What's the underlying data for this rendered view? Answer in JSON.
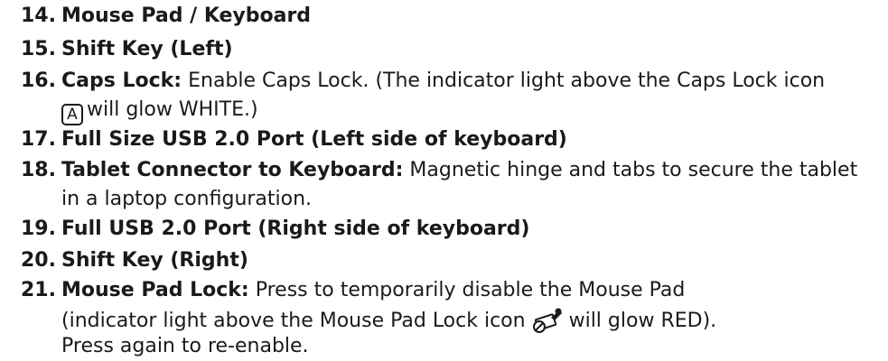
{
  "items": [
    {
      "number": "14.",
      "title": "Mouse Pad / Keyboard"
    },
    {
      "number": "15.",
      "title": "Shift Key (Left)"
    },
    {
      "number": "16.",
      "title": "Caps Lock:",
      "text": "Enable Caps Lock. (The indicator light above the Caps Lock icon",
      "cont_icon": "caps-lock-icon",
      "cont_icon_glyph": "A",
      "cont_text": "will glow WHITE.)"
    },
    {
      "number": "17.",
      "title": "Full Size USB 2.0 Port (Left side of keyboard)"
    },
    {
      "number": "18.",
      "title": "Tablet Connector to Keyboard:",
      "text": "Magnetic hinge and tabs to secure the tablet",
      "cont_text": "in a laptop configuration."
    },
    {
      "number": "19.",
      "title": "Full USB 2.0 Port (Right side of keyboard)"
    },
    {
      "number": "20.",
      "title": "Shift Key (Right)"
    },
    {
      "number": "21.",
      "title": "Mouse Pad Lock:",
      "text": "Press to temporarily disable the Mouse Pad",
      "cont_text_a": "(indicator light above the Mouse Pad Lock icon",
      "cont_icon": "mouse-pad-lock-icon",
      "cont_text_b": "will glow RED).",
      "cont_text_2": "Press again to re-enable."
    }
  ]
}
